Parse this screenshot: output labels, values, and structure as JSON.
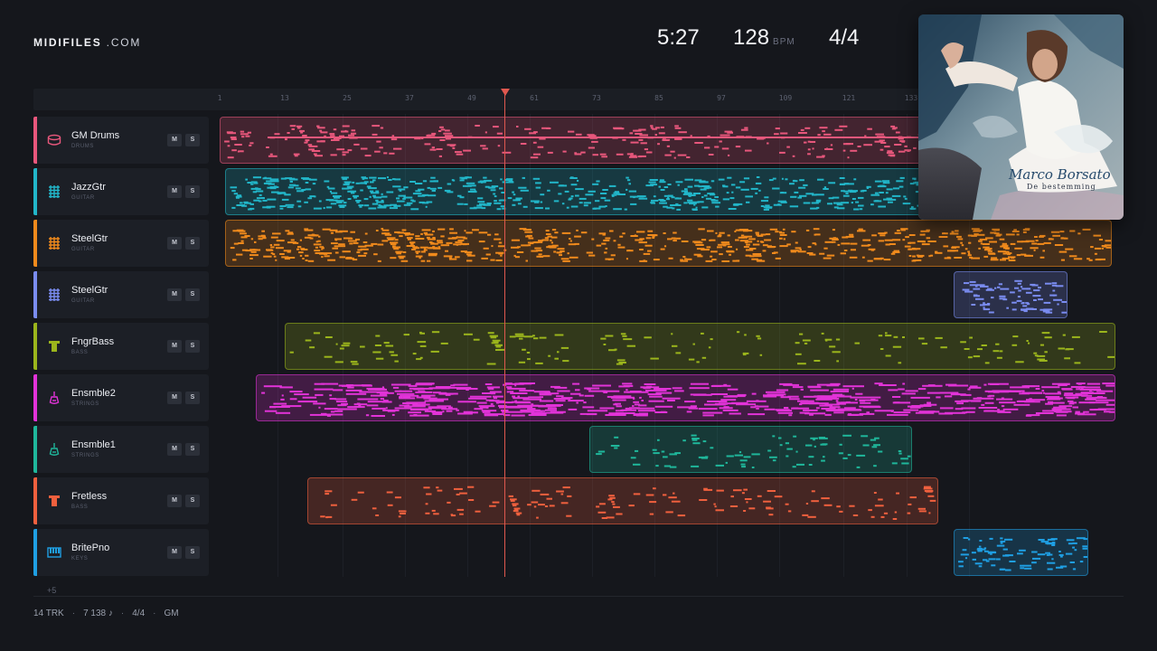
{
  "brand": {
    "name_bold": "MIDIFILES",
    "name_rest": " .COM"
  },
  "transport": {
    "time": "5:27",
    "bpm": "128",
    "bpm_unit": "BPM",
    "time_signature": "4/4"
  },
  "ruler": {
    "ticks": [
      "1",
      "13",
      "25",
      "37",
      "49",
      "61",
      "73",
      "85",
      "97",
      "109",
      "121",
      "133"
    ]
  },
  "playhead": {
    "color": "#e0584f"
  },
  "tracks": [
    {
      "name": "GM Drums",
      "category": "DRUMS",
      "color": "#e8577c",
      "icon": "drum-icon",
      "mute": "M",
      "solo": "S"
    },
    {
      "name": "JazzGtr",
      "category": "GUITAR",
      "color": "#22b6c9",
      "icon": "guitar-icon",
      "mute": "M",
      "solo": "S"
    },
    {
      "name": "SteelGtr",
      "category": "GUITAR",
      "color": "#f08a1c",
      "icon": "guitar-icon",
      "mute": "M",
      "solo": "S"
    },
    {
      "name": "SteelGtr",
      "category": "GUITAR",
      "color": "#7a8cf0",
      "icon": "guitar-icon",
      "mute": "M",
      "solo": "S"
    },
    {
      "name": "FngrBass",
      "category": "BASS",
      "color": "#9bb51c",
      "icon": "bass-icon",
      "mute": "M",
      "solo": "S"
    },
    {
      "name": "Ensmble2",
      "category": "STRINGS",
      "color": "#e233d8",
      "icon": "violin-icon",
      "mute": "M",
      "solo": "S"
    },
    {
      "name": "Ensmble1",
      "category": "STRINGS",
      "color": "#1fb79b",
      "icon": "violin-icon",
      "mute": "M",
      "solo": "S"
    },
    {
      "name": "Fretless",
      "category": "BASS",
      "color": "#f0603e",
      "icon": "bass-icon",
      "mute": "M",
      "solo": "S"
    },
    {
      "name": "BritePno",
      "category": "KEYS",
      "color": "#1f9fe3",
      "icon": "piano-icon",
      "mute": "M",
      "solo": "S"
    }
  ],
  "more_tracks": "+5",
  "footer": {
    "tracks": "14 TRK",
    "notes": "7 138 ♪",
    "signature": "4/4",
    "standard": "GM"
  },
  "album": {
    "artist": "Marco Borsato",
    "title": "De bestemming"
  }
}
